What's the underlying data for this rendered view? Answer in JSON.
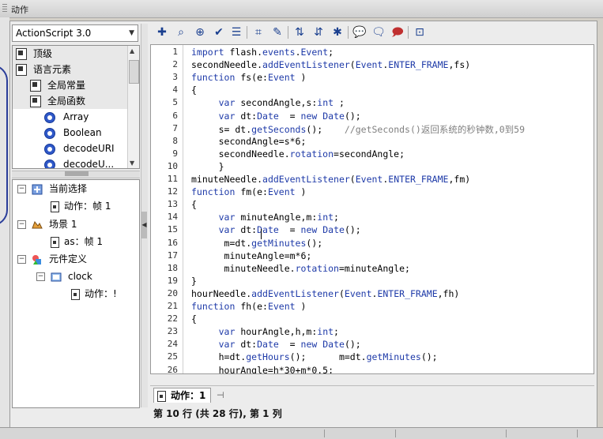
{
  "window": {
    "tab_title": "动作"
  },
  "toolbox": {
    "version": "ActionScript 3.0",
    "items": [
      {
        "label": "顶级",
        "kind": "category"
      },
      {
        "label": "语言元素",
        "kind": "category"
      },
      {
        "label": "全局常量",
        "kind": "category"
      },
      {
        "label": "全局函数",
        "kind": "category"
      },
      {
        "label": "Array",
        "kind": "class"
      },
      {
        "label": "Boolean",
        "kind": "class"
      },
      {
        "label": "decodeURI",
        "kind": "class"
      },
      {
        "label": "decodeU...",
        "kind": "class"
      }
    ]
  },
  "navigator": {
    "current_selection": "当前选择",
    "current_action": "动作：帧 1",
    "scene": "场景 1",
    "scene_action": "as：帧 1",
    "symbol_defs": "元件定义",
    "symbol_clock": "clock",
    "clock_action": "动作：!"
  },
  "editor": {
    "line_numbers": [
      "1",
      "2",
      "3",
      "4",
      "5",
      "6",
      "7",
      "8",
      "9",
      "10",
      "11",
      "12",
      "13",
      "14",
      "15",
      "16",
      "17",
      "18",
      "19",
      "20",
      "21",
      "22",
      "23",
      "24",
      "25",
      "26"
    ],
    "lines": [
      "import flash.events.Event;",
      "secondNeedle.addEventListener(Event.ENTER_FRAME,fs)",
      "function fs(e:Event )",
      "{",
      "     var secondAngle,s:int ;",
      "     var dt:Date  = new Date();",
      "     s= dt.getSeconds();    //getSeconds()返回系统的秒钟数,0到59",
      "     secondAngle=s*6;",
      "     secondNeedle.rotation=secondAngle;",
      "     }",
      "minuteNeedle.addEventListener(Event.ENTER_FRAME,fm)",
      "function fm(e:Event )",
      "{",
      "     var minuteAngle,m:int;",
      "     var dt:Date  = new Date();",
      "      m=dt.getMinutes();",
      "      minuteAngle=m*6;",
      "      minuteNeedle.rotation=minuteAngle;",
      "}",
      "hourNeedle.addEventListener(Event.ENTER_FRAME,fh)",
      "function fh(e:Event )",
      "{",
      "     var hourAngle,h,m:int;",
      "     var dt:Date  = new Date();",
      "     h=dt.getHours();      m=dt.getMinutes();",
      "     hourAngle=h*30+m*0.5;"
    ]
  },
  "script_tab": {
    "label": "动作：1"
  },
  "status": {
    "text": "第 10 行 (共 28 行), 第 1 列"
  },
  "icons": [
    "add-statement-icon",
    "find-icon",
    "target-icon",
    "check-syntax-icon",
    "auto-format-icon",
    "code-hint-icon",
    "debug-icon",
    "collapse-braces-icon",
    "collapse-selection-icon",
    "expand-all-icon",
    "comment-block-icon",
    "comment-line-icon",
    "uncomment-icon",
    "script-assist-icon"
  ]
}
